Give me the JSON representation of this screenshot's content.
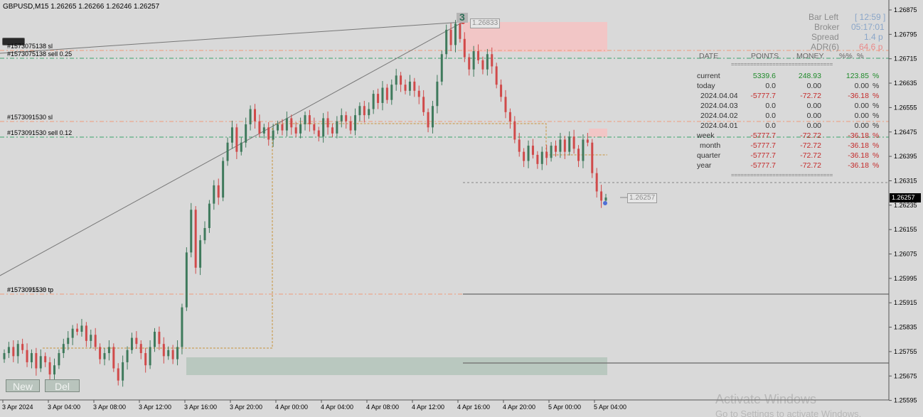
{
  "symbol_title": "GBPUSD,M15  1.26265 1.26266 1.26246 1.26257",
  "wave_label": "3",
  "high_price_tag": "1.26833",
  "current_price_tag": "1.26257",
  "current_price_axis": "1.26257",
  "trade_labels": {
    "sl1": "#1573075138 sl",
    "sell1": "#1573075138 sell 0.25",
    "sl2": "#1573091530 sl",
    "sell2": "#1573091530 sell 0.12",
    "tp": "#1573091530 tp",
    "tp_overlap": "#1573075138 tp"
  },
  "info_panel": {
    "bar_left_label": "Bar Left",
    "bar_left_value": "[ 12:59 ]",
    "broker_label": "Broker",
    "broker_value": "05:17:01",
    "spread_label": "Spread",
    "spread_value": "1.4 p",
    "adr_label": "ADR(6)",
    "adr_value": "64.6 p"
  },
  "stats_table": {
    "headers": [
      "DATE",
      "POINTS",
      "MONEY",
      "%%",
      "%"
    ],
    "separator": "================================",
    "rows": [
      {
        "label": "current",
        "points": "5339.6",
        "money": "248.93",
        "pct": "123.85",
        "unit": "%",
        "tone": "pos"
      },
      {
        "label": "today",
        "points": "0.0",
        "money": "0.00",
        "pct": "0.00",
        "unit": "%",
        "tone": "zero"
      },
      {
        "label": "2024.04.04",
        "points": "-5777.7",
        "money": "-72.72",
        "pct": "-36.18",
        "unit": "%",
        "tone": "neg"
      },
      {
        "label": "2024.04.03",
        "points": "0.0",
        "money": "0.00",
        "pct": "0.00",
        "unit": "%",
        "tone": "zero"
      },
      {
        "label": "2024.04.02",
        "points": "0.0",
        "money": "0.00",
        "pct": "0.00",
        "unit": "%",
        "tone": "zero"
      },
      {
        "label": "2024.04.01",
        "points": "0.0",
        "money": "0.00",
        "pct": "0.00",
        "unit": "%",
        "tone": "zero"
      },
      {
        "label": "week",
        "points": "-5777.7",
        "money": "-72.72",
        "pct": "-36.18",
        "unit": "%",
        "tone": "neg"
      },
      {
        "label": "month",
        "points": "-5777.7",
        "money": "-72.72",
        "pct": "-36.18",
        "unit": "%",
        "tone": "neg"
      },
      {
        "label": "quarter",
        "points": "-5777.7",
        "money": "-72.72",
        "pct": "-36.18",
        "unit": "%",
        "tone": "neg"
      },
      {
        "label": "year",
        "points": "-5777.7",
        "money": "-72.72",
        "pct": "-36.18",
        "unit": "%",
        "tone": "neg"
      }
    ]
  },
  "buttons": {
    "new_label": "New",
    "del_label": "Del"
  },
  "watermark": {
    "line1": "Activate Windows",
    "line2": "Go to Settings to activate Windows."
  },
  "colors": {
    "background": "#d9d9d9",
    "bull": "#3f7a5c",
    "bear": "#d04a4a",
    "positive_text": "#1f8a2a",
    "negative_text": "#c42a2a",
    "sell_line": "#39a36a",
    "sl_line": "#ee9b7a",
    "sl_zone": "#f2c6c6",
    "tp_zone": "#b9c8bf",
    "order_line": "#c8923a"
  },
  "chart_data": {
    "type": "candlestick",
    "timeframe": "M15",
    "x_tick_labels": [
      "3 Apr 2024",
      "3 Apr 04:00",
      "3 Apr 08:00",
      "3 Apr 12:00",
      "3 Apr 16:00",
      "3 Apr 20:00",
      "4 Apr 00:00",
      "4 Apr 04:00",
      "4 Apr 08:00",
      "4 Apr 12:00",
      "4 Apr 16:00",
      "4 Apr 20:00",
      "5 Apr 00:00",
      "5 Apr 04:00"
    ],
    "y_tick_labels": [
      "1.26875",
      "1.26795",
      "1.26715",
      "1.26635",
      "1.26555",
      "1.26475",
      "1.26395",
      "1.26315",
      "1.26235",
      "1.26155",
      "1.26075",
      "1.25995",
      "1.25915",
      "1.25835",
      "1.25755",
      "1.25675",
      "1.25595"
    ],
    "ylim": [
      1.2558,
      1.269
    ],
    "levels": {
      "sell_0_25_entry": 1.2673,
      "sl_0_25": 1.2675,
      "sell_0_12_entry": 1.2646,
      "sl_0_12": 1.2652,
      "tp": 1.2596,
      "current": 1.26257,
      "high": 1.26833,
      "order_upper": 1.2651,
      "order_lower": 1.2575
    },
    "closes": [
      1.2575,
      1.2577,
      1.2574,
      1.2578,
      1.2576,
      1.2572,
      1.2575,
      1.257,
      1.2574,
      1.2572,
      1.2568,
      1.2571,
      1.2575,
      1.2578,
      1.258,
      1.2583,
      1.2582,
      1.2584,
      1.2579,
      1.2581,
      1.2577,
      1.2573,
      1.2575,
      1.2577,
      1.257,
      1.2566,
      1.2572,
      1.2576,
      1.258,
      1.2578,
      1.2575,
      1.2571,
      1.2577,
      1.2582,
      1.2578,
      1.2574,
      1.2576,
      1.2573,
      1.2577,
      1.259,
      1.2608,
      1.2622,
      1.2603,
      1.2612,
      1.2616,
      1.2624,
      1.263,
      1.2626,
      1.2638,
      1.2644,
      1.2649,
      1.2641,
      1.2644,
      1.265,
      1.2655,
      1.2651,
      1.2647,
      1.2649,
      1.2645,
      1.2648,
      1.265,
      1.2648,
      1.2652,
      1.2649,
      1.2647,
      1.265,
      1.2653,
      1.265,
      1.2648,
      1.2646,
      1.2652,
      1.2649,
      1.2647,
      1.2651,
      1.2653,
      1.2651,
      1.2648,
      1.2653,
      1.2656,
      1.2653,
      1.2655,
      1.266,
      1.2657,
      1.2662,
      1.2658,
      1.2663,
      1.2666,
      1.2663,
      1.2661,
      1.2664,
      1.2661,
      1.2659,
      1.2654,
      1.2649,
      1.2656,
      1.2664,
      1.2673,
      1.2681,
      1.2676,
      1.2683,
      1.2678,
      1.2672,
      1.2668,
      1.2674,
      1.2671,
      1.2668,
      1.2673,
      1.2669,
      1.2663,
      1.2659,
      1.2654,
      1.2651,
      1.2645,
      1.2641,
      1.2638,
      1.2643,
      1.264,
      1.2637,
      1.2641,
      1.2639,
      1.2643,
      1.2641,
      1.2645,
      1.2641,
      1.2646,
      1.2642,
      1.2638,
      1.2645,
      1.2644,
      1.2634,
      1.2628,
      1.2625,
      1.2626
    ]
  }
}
